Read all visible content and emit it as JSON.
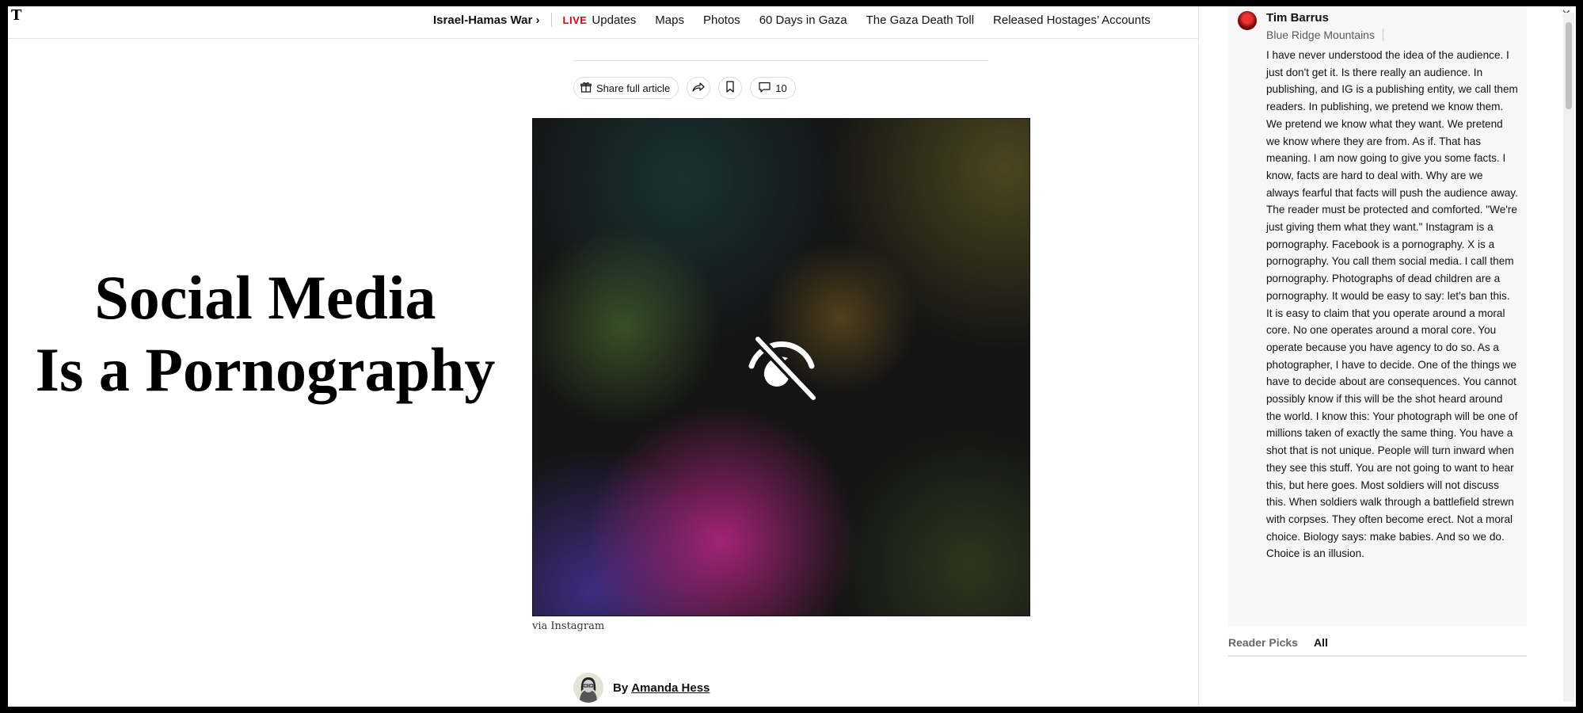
{
  "nav": {
    "logo": "T",
    "section": "Israel-Hamas War ›",
    "live_tag": "LIVE",
    "items": [
      "Updates",
      "Maps",
      "Photos",
      "60 Days in Gaza",
      "The Gaza Death Toll",
      "Released Hostages’ Accounts"
    ]
  },
  "share_bar": {
    "share_full_label": "Share full article",
    "comment_count": "10",
    "icons": [
      "gift-icon",
      "share-arrow-icon",
      "bookmark-icon",
      "comment-icon"
    ]
  },
  "headline": {
    "line1": "Social Media",
    "line2": "Is a Pornography"
  },
  "hero": {
    "caption": "via Instagram",
    "overlay_icon": "eye-slash-icon"
  },
  "byline": {
    "prefix": "By",
    "author": "Amanda Hess"
  },
  "comment": {
    "name": "Tim Barrus",
    "location": "Blue Ridge Mountains",
    "text": "I have never understood the idea of the audience. I just don't get it. Is there really an audience. In publishing, and IG is a publishing entity, we call them readers. In publishing, we pretend we know them. We pretend we know what they want. We pretend we know where they are from. As if. That has meaning. I am now going to give you some facts. I know, facts are hard to deal with. Why are we always fearful that facts will push the audience away. The reader must be protected and comforted. \"We're just giving them what they want.\" Instagram is a pornography. Facebook is a pornography. X is a pornography. You call them social media. I call them pornography. Photographs of dead children are a pornography. It would be easy to say: let's ban this. It is easy to claim that you operate around a moral core. No one operates around a moral core. You operate because you have agency to do so. As a photographer, I have to decide. One of the things we have to decide about are consequences. You cannot possibly know if this will be the shot heard around the world. I know this: Your photograph will be one of millions taken of exactly the same thing. You have a shot that is not unique. People will turn inward when they see this stuff. You are not going to want to hear this, but here goes. Most soldiers will not discuss this. When soldiers walk through a battlefield strewn with corpses. They often become erect. Not a moral choice. Biology says: make babies. And so we do. Choice is an illusion."
  },
  "tabs": {
    "reader_picks": "Reader Picks",
    "all": "All"
  },
  "panel": {
    "close": "×"
  },
  "colors": {
    "live_red": "#d0021b",
    "text": "#121212",
    "panel_card": "#f7f7f7"
  }
}
